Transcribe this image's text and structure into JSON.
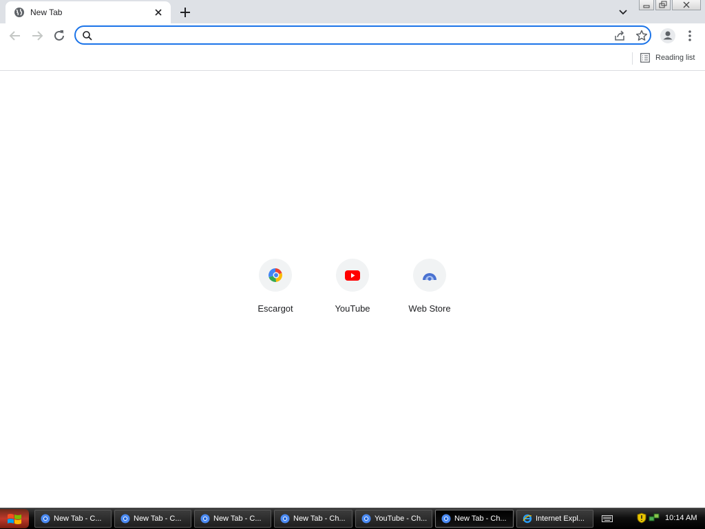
{
  "browser": {
    "tab": {
      "title": "New Tab",
      "favicon": "globe-icon"
    },
    "toolbar": {
      "omnibox_value": "",
      "omnibox_placeholder": ""
    },
    "bookmarks_bar": {
      "reading_list_label": "Reading list"
    },
    "accent_color": "#1a73e8"
  },
  "shortcuts": [
    {
      "label": "Escargot",
      "icon": "escargot-icon"
    },
    {
      "label": "YouTube",
      "icon": "youtube-icon"
    },
    {
      "label": "Web Store",
      "icon": "web-store-icon"
    }
  ],
  "taskbar": {
    "items": [
      {
        "label": "New Tab - C...",
        "icon": "chrome-icon",
        "active": false
      },
      {
        "label": "New Tab - C...",
        "icon": "chrome-icon",
        "active": false
      },
      {
        "label": "New Tab - C...",
        "icon": "chrome-icon",
        "active": false
      },
      {
        "label": "New Tab - Ch...",
        "icon": "chrome-icon",
        "active": false
      },
      {
        "label": "YouTube - Ch...",
        "icon": "chrome-icon",
        "active": false
      },
      {
        "label": "New Tab - Ch...",
        "icon": "chrome-icon",
        "active": true
      },
      {
        "label": "Internet Expl...",
        "icon": "internet-explorer-icon",
        "active": false
      }
    ],
    "clock": "10:14 AM"
  }
}
